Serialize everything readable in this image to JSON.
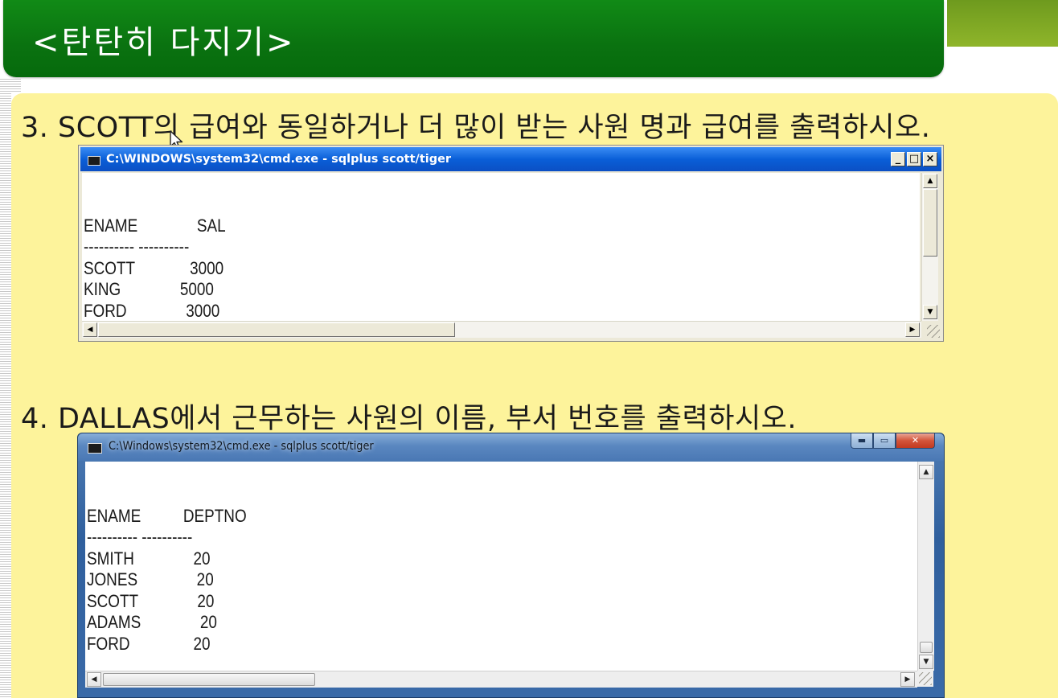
{
  "slide": {
    "title": "<탄탄히 다지기>",
    "question3": "3. SCOTT의 급여와 동일하거나 더 많이 받는 사원 명과 급여를 출력하시오.",
    "question4": "4. DALLAS에서 근무하는 사원의 이름, 부서 번호를 출력하시오."
  },
  "window1": {
    "title": "C:\\WINDOWS\\system32\\cmd.exe - sqlplus scott/tiger",
    "min_label": "_",
    "max_label": "□",
    "close_label": "×",
    "console_lines": [
      "",
      "ENAME              SAL",
      "---------- ----------",
      "SCOTT             3000",
      "KING              5000",
      "FORD              3000"
    ]
  },
  "window2": {
    "title": "C:\\Windows\\system32\\cmd.exe - sqlplus  scott/tiger",
    "min_label": "▬",
    "max_label": "▭",
    "close_label": "✕",
    "console_lines": [
      "",
      "ENAME          DEPTNO",
      "---------- ----------",
      "SMITH              20",
      "JONES              20",
      "SCOTT              20",
      "ADAMS              20",
      "FORD               20"
    ]
  },
  "colors": {
    "banner_green": "#0a7210",
    "panel_yellow": "#fdf39b",
    "xp_titlebar_blue": "#0a5fd8",
    "w7_frame_blue": "#3a6aa8"
  },
  "icons": [
    "cmd-icon",
    "mouse-cursor-icon",
    "scroll-arrow-icon",
    "resize-grip-icon"
  ]
}
